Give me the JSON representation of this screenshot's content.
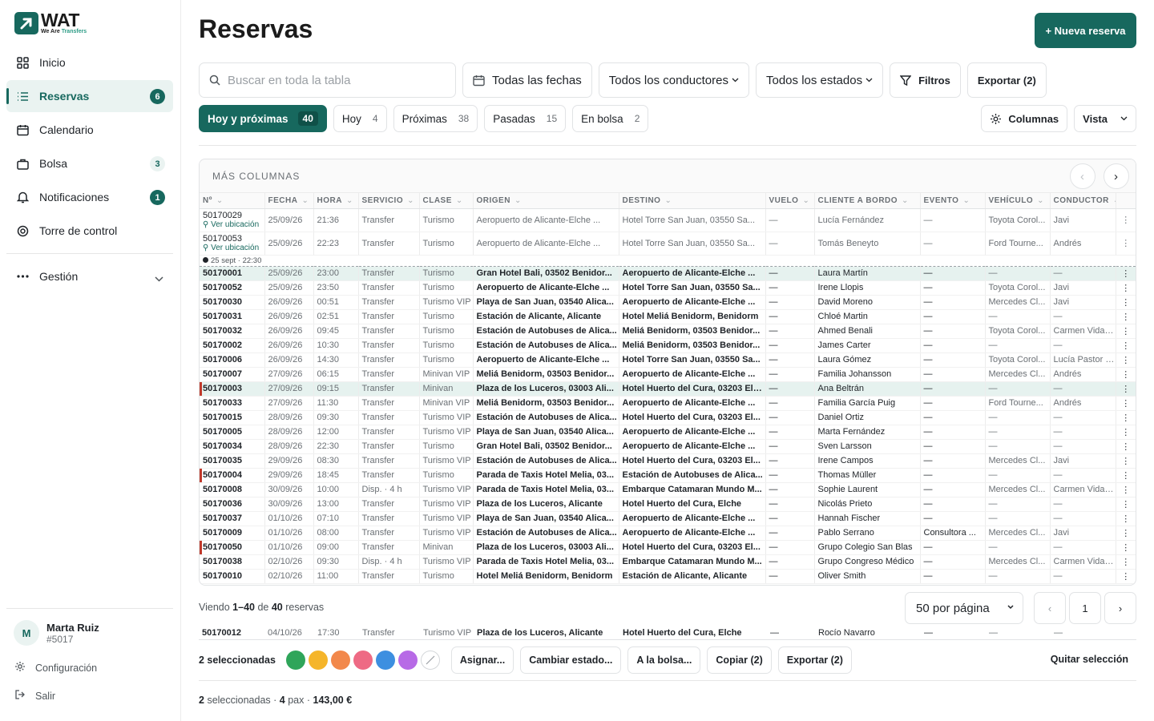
{
  "brand": {
    "name": "WAT",
    "tagline_a": "We Are ",
    "tagline_b": "Transfers",
    "color": "#17685e"
  },
  "sidebar": {
    "items": [
      {
        "label": "Inicio",
        "icon": "grid-icon",
        "badge": ""
      },
      {
        "label": "Reservas",
        "icon": "list-icon",
        "badge": "6"
      },
      {
        "label": "Calendario",
        "icon": "calendar-icon",
        "badge": ""
      },
      {
        "label": "Bolsa",
        "icon": "bag-icon",
        "badge": "3"
      },
      {
        "label": "Notificaciones",
        "icon": "bell-icon",
        "badge": "1"
      },
      {
        "label": "Torre de control",
        "icon": "target-icon",
        "badge": ""
      }
    ],
    "gestion": "Gestión",
    "user": {
      "initial": "M",
      "name": "Marta Ruiz",
      "id": "#5017"
    },
    "settings": "Configuración",
    "logout": "Salir"
  },
  "header": {
    "title": "Reservas",
    "new_button": "+ Nueva reserva"
  },
  "toolbar": {
    "search_placeholder": "Buscar en toda la tabla",
    "dates": "Todas las fechas",
    "drivers": "Todos los conductores",
    "states": "Todos los estados",
    "filters": "Filtros",
    "export": "Exportar (2)"
  },
  "tabs": [
    {
      "label": "Hoy y próximas",
      "count": "40"
    },
    {
      "label": "Hoy",
      "count": "4"
    },
    {
      "label": "Próximas",
      "count": "38"
    },
    {
      "label": "Pasadas",
      "count": "15"
    },
    {
      "label": "En bolsa",
      "count": "2"
    }
  ],
  "view_tools": {
    "columns": "Columnas",
    "view": "Vista"
  },
  "table": {
    "more_columns": "MÁS COLUMNAS",
    "headers": [
      "Nº",
      "FECHA",
      "HORA",
      "SERVICIO",
      "CLASE",
      "ORIGEN",
      "DESTINO",
      "VUELO",
      "CLIENTE A BORDO",
      "EVENTO",
      "VEHÍCULO",
      "CONDUCTOR"
    ],
    "location_link": "Ver ubicación",
    "now_marker": "25 sept · 22:30",
    "context_rows": [
      [
        "50170029",
        "25/09/26",
        "21:36",
        "Transfer",
        "Turismo",
        "Aeropuerto de Alicante-Elche ...",
        "Hotel Torre San Juan, 03550 Sa...",
        "—",
        "Lucía Fernández",
        "—",
        "Toyota Corol...",
        "Javi"
      ],
      [
        "50170053",
        "25/09/26",
        "22:23",
        "Transfer",
        "Turismo",
        "Aeropuerto de Alicante-Elche ...",
        "Hotel Torre San Juan, 03550 Sa...",
        "—",
        "Tomás Beneyto",
        "—",
        "Ford Tourne...",
        "Andrés"
      ]
    ],
    "rows": [
      [
        "50170001",
        "25/09/26",
        "23:00",
        "Transfer",
        "Turismo",
        "Gran Hotel Bali, 03502 Benidor...",
        "Aeropuerto de Alicante-Elche ...",
        "—",
        "Laura Martín",
        "—",
        "—",
        "—"
      ],
      [
        "50170052",
        "25/09/26",
        "23:50",
        "Transfer",
        "Turismo",
        "Aeropuerto de Alicante-Elche ...",
        "Hotel Torre San Juan, 03550 Sa...",
        "—",
        "Irene Llopis",
        "—",
        "Toyota Corol...",
        "Javi"
      ],
      [
        "50170030",
        "26/09/26",
        "00:51",
        "Transfer",
        "Turismo VIP",
        "Playa de San Juan, 03540 Alica...",
        "Aeropuerto de Alicante-Elche ...",
        "—",
        "David Moreno",
        "—",
        "Mercedes Cl...",
        "Javi"
      ],
      [
        "50170031",
        "26/09/26",
        "02:51",
        "Transfer",
        "Turismo",
        "Estación de Alicante, Alicante",
        "Hotel Meliá Benidorm, Benidorm",
        "—",
        "Chloé Martin",
        "—",
        "—",
        "—"
      ],
      [
        "50170032",
        "26/09/26",
        "09:45",
        "Transfer",
        "Turismo",
        "Estación de Autobuses de Alica...",
        "Meliá Benidorm, 03503 Benidor...",
        "—",
        "Ahmed Benali",
        "—",
        "Toyota Corol...",
        "Carmen Vidal ..."
      ],
      [
        "50170002",
        "26/09/26",
        "10:30",
        "Transfer",
        "Turismo",
        "Estación de Autobuses de Alica...",
        "Meliá Benidorm, 03503 Benidor...",
        "—",
        "James Carter",
        "—",
        "—",
        "—"
      ],
      [
        "50170006",
        "26/09/26",
        "14:30",
        "Transfer",
        "Turismo",
        "Aeropuerto de Alicante-Elche ...",
        "Hotel Torre San Juan, 03550 Sa...",
        "—",
        "Laura Gómez",
        "—",
        "Toyota Corol...",
        "Lucía Pastor Gil"
      ],
      [
        "50170007",
        "27/09/26",
        "06:15",
        "Transfer",
        "Minivan VIP",
        "Meliá Benidorm, 03503 Benidor...",
        "Aeropuerto de Alicante-Elche ...",
        "—",
        "Familia Johansson",
        "—",
        "Mercedes Cl...",
        "Andrés"
      ],
      [
        "50170003",
        "27/09/26",
        "09:15",
        "Transfer",
        "Minivan",
        "Plaza de los Luceros, 03003 Ali...",
        "Hotel Huerto del Cura, 03203 Elche",
        "—",
        "Ana Beltrán",
        "—",
        "—",
        "—"
      ],
      [
        "50170033",
        "27/09/26",
        "11:30",
        "Transfer",
        "Minivan VIP",
        "Meliá Benidorm, 03503 Benidor...",
        "Aeropuerto de Alicante-Elche ...",
        "—",
        "Familia García Puig",
        "—",
        "Ford Tourne...",
        "Andrés"
      ],
      [
        "50170015",
        "28/09/26",
        "09:30",
        "Transfer",
        "Turismo VIP",
        "Estación de Autobuses de Alica...",
        "Hotel Huerto del Cura, 03203 El...",
        "—",
        "Daniel Ortiz",
        "—",
        "—",
        "—"
      ],
      [
        "50170005",
        "28/09/26",
        "12:00",
        "Transfer",
        "Turismo VIP",
        "Playa de San Juan, 03540 Alica...",
        "Aeropuerto de Alicante-Elche ...",
        "—",
        "Marta Fernández",
        "—",
        "—",
        "—"
      ],
      [
        "50170034",
        "28/09/26",
        "22:30",
        "Transfer",
        "Turismo",
        "Gran Hotel Bali, 03502 Benidor...",
        "Aeropuerto de Alicante-Elche ...",
        "—",
        "Sven Larsson",
        "—",
        "—",
        "—"
      ],
      [
        "50170035",
        "29/09/26",
        "08:30",
        "Transfer",
        "Turismo VIP",
        "Estación de Autobuses de Alica...",
        "Hotel Huerto del Cura, 03203 El...",
        "—",
        "Irene Campos",
        "—",
        "Mercedes Cl...",
        "Javi"
      ],
      [
        "50170004",
        "29/09/26",
        "18:45",
        "Transfer",
        "Turismo",
        "Parada de Taxis Hotel Melia, 03...",
        "Estación de Autobuses de Alica...",
        "—",
        "Thomas Müller",
        "—",
        "—",
        "—"
      ],
      [
        "50170008",
        "30/09/26",
        "10:00",
        "Disp. · 4 h",
        "Turismo VIP",
        "Parada de Taxis Hotel Melia, 03...",
        "Embarque Catamaran Mundo M...",
        "—",
        "Sophie Laurent",
        "—",
        "Mercedes Cl...",
        "Carmen Vidal ..."
      ],
      [
        "50170036",
        "30/09/26",
        "13:00",
        "Transfer",
        "Turismo VIP",
        "Plaza de los Luceros, Alicante",
        "Hotel Huerto del Cura, Elche",
        "—",
        "Nicolás Prieto",
        "—",
        "—",
        "—"
      ],
      [
        "50170037",
        "01/10/26",
        "07:10",
        "Transfer",
        "Turismo VIP",
        "Playa de San Juan, 03540 Alica...",
        "Aeropuerto de Alicante-Elche ...",
        "—",
        "Hannah Fischer",
        "—",
        "—",
        "—"
      ],
      [
        "50170009",
        "01/10/26",
        "08:00",
        "Transfer",
        "Turismo VIP",
        "Estación de Autobuses de Alica...",
        "Aeropuerto de Alicante-Elche ...",
        "—",
        "Pablo Serrano",
        "Consultora ...",
        "Mercedes Cl...",
        "Javi"
      ],
      [
        "50170050",
        "01/10/26",
        "09:00",
        "Transfer",
        "Minivan",
        "Plaza de los Luceros, 03003 Ali...",
        "Hotel Huerto del Cura, 03203 El...",
        "—",
        "Grupo Colegio San Blas",
        "—",
        "—",
        "—"
      ],
      [
        "50170038",
        "02/10/26",
        "09:30",
        "Disp. · 4 h",
        "Turismo VIP",
        "Parada de Taxis Hotel Melia, 03...",
        "Embarque Catamaran Mundo M...",
        "—",
        "Grupo Congreso Médico",
        "—",
        "Mercedes Cl...",
        "Carmen Vidal ..."
      ],
      [
        "50170010",
        "02/10/26",
        "11:00",
        "Transfer",
        "Turismo",
        "Hotel Meliá Benidorm, Benidorm",
        "Estación de Alicante, Alicante",
        "—",
        "Oliver Smith",
        "—",
        "—",
        "—"
      ]
    ],
    "selected_rows": [
      0,
      8
    ],
    "flagged_rows": [
      8,
      14,
      19
    ],
    "row_menu": "⋮"
  },
  "pagination": {
    "info_a": "Viendo ",
    "range": "1–40",
    "info_b": " de ",
    "total": "40",
    "info_c": " reservas",
    "per_page": "50 por página",
    "page": "1",
    "prev": "‹",
    "next": "›"
  },
  "peek_row": [
    "50170012",
    "04/10/26",
    "17:30",
    "Transfer",
    "Turismo VIP",
    "Plaza de los Luceros, Alicante",
    "Hotel Huerto del Cura, Elche",
    "—",
    "Rocío Navarro",
    "—",
    "—",
    "—"
  ],
  "selection_bar": {
    "count": "2 seleccionadas",
    "colors": [
      "#2fa55a",
      "#f5b52a",
      "#f2884b",
      "#ee6a84",
      "#3d8fe0",
      "#b76ae6"
    ],
    "assign": "Asignar...",
    "change_state": "Cambiar estado...",
    "to_pool": "A la bolsa...",
    "copy": "Copiar (2)",
    "export": "Exportar (2)",
    "clear": "Quitar selección"
  },
  "summary": {
    "selected": "2",
    "selected_label": "seleccionadas ·",
    "pax": "4",
    "pax_label": "pax ·",
    "amount": "143,00 €"
  }
}
